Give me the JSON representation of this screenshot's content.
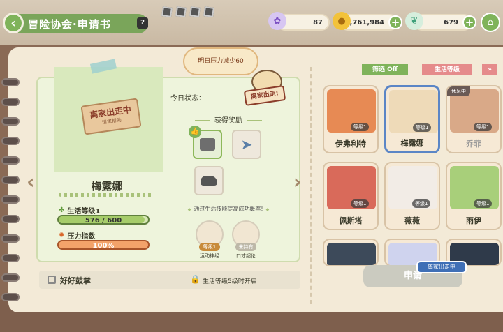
{
  "header": {
    "title": "冒险协会·申请书",
    "help": "?"
  },
  "resources": [
    {
      "icon": "purple-gem-icon",
      "value": "87"
    },
    {
      "icon": "gold-coin-icon",
      "value": "2,761,984"
    },
    {
      "icon": "leaf-crystal-icon",
      "value": "679"
    }
  ],
  "status": {
    "bubble": "明日压力减少60",
    "label": "今日状态：",
    "stamp": "离家出走!"
  },
  "character": {
    "name": "梅露娜",
    "sign_main": "离家出走中",
    "sign_sub": "请求帮助",
    "life_level_label": "生活等级1",
    "life_exp": "576 / 600",
    "life_exp_fraction": 0.96,
    "stress_label": "压力指数",
    "stress_value": "100%"
  },
  "rewards": {
    "title": "获得奖励",
    "items": [
      "metal-ore-icon",
      "fish-icon",
      "stone-icon"
    ],
    "tip": "通过生活技能提高成功概率!"
  },
  "skills": [
    {
      "tag": "等级1",
      "name": "运动神经",
      "tag_color": "#c88a3a"
    },
    {
      "tag": "未持有",
      "name": "口才超伦",
      "tag_color": "#bdb8a8"
    }
  ],
  "footer": {
    "encourage": "好好鼓掌",
    "lock_text": "生活等级5级时开启"
  },
  "filters": {
    "filter": "筛选 Off",
    "sort": "生活等级",
    "toggle": "»"
  },
  "cards": [
    {
      "name": "伊弗利特",
      "level": "等级1",
      "badge": ""
    },
    {
      "name": "梅露娜",
      "level": "等级1",
      "badge": ""
    },
    {
      "name": "乔菲",
      "level": "等级1",
      "badge": "休息中"
    },
    {
      "name": "佩斯塔",
      "level": "等级1",
      "badge": ""
    },
    {
      "name": "薇薇",
      "level": "等级1",
      "badge": ""
    },
    {
      "name": "雨伊",
      "level": "等级1",
      "badge": ""
    }
  ],
  "apply": "申请",
  "tooltip": "离家出走中",
  "colors": {
    "accent_green": "#7fb35a",
    "stress_orange": "#f3a36a",
    "select_blue": "#5b86c6"
  }
}
